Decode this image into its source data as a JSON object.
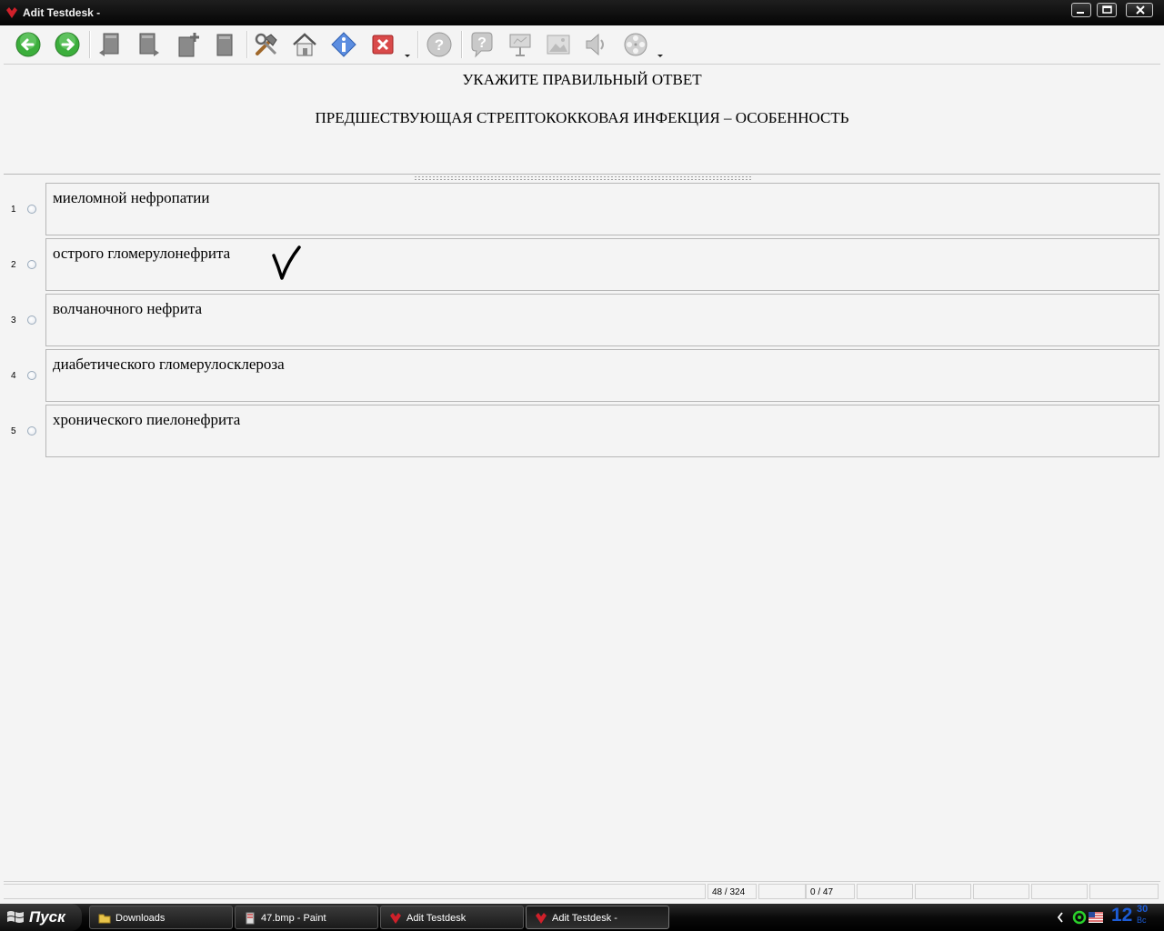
{
  "window": {
    "title": "Adit Testdesk -"
  },
  "toolbar": {
    "buttons": [
      {
        "name": "back",
        "icon": "arrow-left-icon"
      },
      {
        "name": "forward",
        "icon": "arrow-right-icon"
      },
      {
        "name": "prev-question",
        "icon": "page-left-icon"
      },
      {
        "name": "next-question",
        "icon": "page-right-icon"
      },
      {
        "name": "add-page",
        "icon": "page-add-icon"
      },
      {
        "name": "bookmark",
        "icon": "page-icon"
      },
      {
        "name": "tools",
        "icon": "tools-icon"
      },
      {
        "name": "home",
        "icon": "home-icon"
      },
      {
        "name": "info",
        "icon": "info-icon"
      },
      {
        "name": "close",
        "icon": "close-icon"
      },
      {
        "name": "help",
        "icon": "help-icon"
      },
      {
        "name": "hint",
        "icon": "question-icon"
      },
      {
        "name": "presentation",
        "icon": "presentation-icon"
      },
      {
        "name": "image",
        "icon": "image-icon"
      },
      {
        "name": "sound",
        "icon": "speaker-icon"
      },
      {
        "name": "video",
        "icon": "film-reel-icon"
      }
    ]
  },
  "question": {
    "instruction": "УКАЖИТЕ ПРАВИЛЬНЫЙ ОТВЕТ",
    "text": "ПРЕДШЕСТВУЮЩАЯ СТРЕПТОКОККОВАЯ ИНФЕКЦИЯ – ОСОБЕННОСТЬ"
  },
  "answers": [
    {
      "number": "1",
      "text": "миеломной нефропатии",
      "checked": false
    },
    {
      "number": "2",
      "text": "острого гломерулонефрита",
      "checked": false,
      "annotated": true
    },
    {
      "number": "3",
      "text": "волчаночного нефрита",
      "checked": false
    },
    {
      "number": "4",
      "text": "диабетического гломерулосклероза",
      "checked": false
    },
    {
      "number": "5",
      "text": "хронического пиелонефрита",
      "checked": false
    }
  ],
  "status": {
    "question_counter": "48 / 324",
    "answered_counter": "0 / 47"
  },
  "taskbar": {
    "start_label": "Пуск",
    "tasks": [
      {
        "label": "Downloads",
        "icon": "folder-icon"
      },
      {
        "label": "47.bmp - Paint",
        "icon": "paint-icon"
      },
      {
        "label": "Adit Testdesk",
        "icon": "testdesk-icon"
      },
      {
        "label": "Adit Testdesk -",
        "icon": "testdesk-icon",
        "active": true
      }
    ],
    "clock_hour": "12",
    "clock_minute": "30",
    "clock_day": "Вс"
  },
  "colors": {
    "accent": "#1c5cd6",
    "window_bg": "#f4f4f4",
    "titlebar": "#0a0a0a",
    "brand": "#d0202a"
  }
}
